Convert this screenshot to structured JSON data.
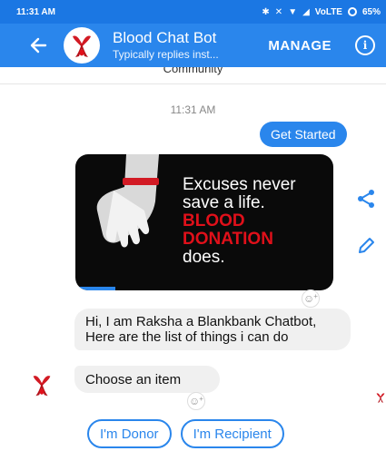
{
  "status_bar": {
    "time": "11:31 AM",
    "network": "VoLTE",
    "battery": "65%",
    "icons": [
      "bluetooth-icon",
      "mute-icon",
      "wifi-icon",
      "signal-icon",
      "battery-icon"
    ]
  },
  "header": {
    "title": "Blood Chat Bot",
    "subtitle": "Typically replies inst...",
    "manage_label": "MANAGE",
    "info_label": "i",
    "back_icon": "arrow-left-icon"
  },
  "chat": {
    "community_text": "Community",
    "timestamp": "11:31 AM",
    "user_message": "Get Started",
    "image_card": {
      "line1": "Excuses never",
      "line2": "save a life.",
      "line3": "BLOOD",
      "line4": "DONATION",
      "line5": "does."
    },
    "bot_message_1": "Hi, I am Raksha a Blankbank Chatbot, Here are the list of things i can do",
    "bot_message_2": "Choose an item",
    "reaction_plus": "+",
    "quick_replies": [
      "I'm Donor",
      "I'm Recipient"
    ]
  },
  "colors": {
    "status_bar": "#1b77e3",
    "app_bar": "#2a86ec",
    "accent": "#2a86ec",
    "bubble_gray": "#f0f0f0",
    "blood_red": "#e0101a"
  }
}
